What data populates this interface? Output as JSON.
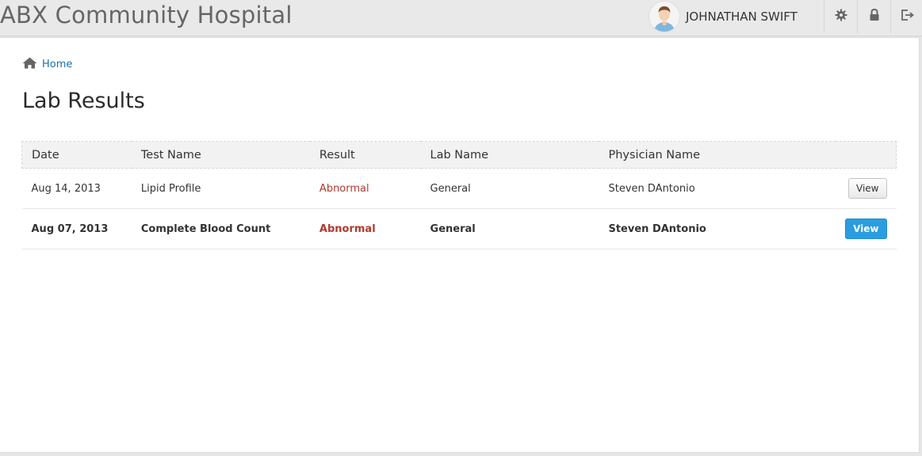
{
  "app": {
    "title": "ABX Community Hospital"
  },
  "user": {
    "name": "JOHNATHAN SWIFT"
  },
  "toolbar": {
    "settings_icon": "gear-icon",
    "lock_icon": "lock-icon",
    "logout_icon": "logout-icon"
  },
  "breadcrumb": {
    "home_label": "Home",
    "icon": "home-icon"
  },
  "page": {
    "title": "Lab Results"
  },
  "table": {
    "headers": {
      "date": "Date",
      "test": "Test Name",
      "result": "Result",
      "lab": "Lab Name",
      "physician": "Physician Name"
    },
    "rows": [
      {
        "date": "Aug 14, 2013",
        "test": "Lipid Profile",
        "result": "Abnormal",
        "lab": "General",
        "physician": "Steven DAntonio",
        "action": "View",
        "unread": false
      },
      {
        "date": "Aug 07, 2013",
        "test": "Complete Blood Count",
        "result": "Abnormal",
        "lab": "General",
        "physician": "Steven DAntonio",
        "action": "View",
        "unread": true
      }
    ]
  },
  "colors": {
    "abnormal": "#b03a2e",
    "link": "#1a6fb0",
    "primary_button": "#2a9de0"
  }
}
